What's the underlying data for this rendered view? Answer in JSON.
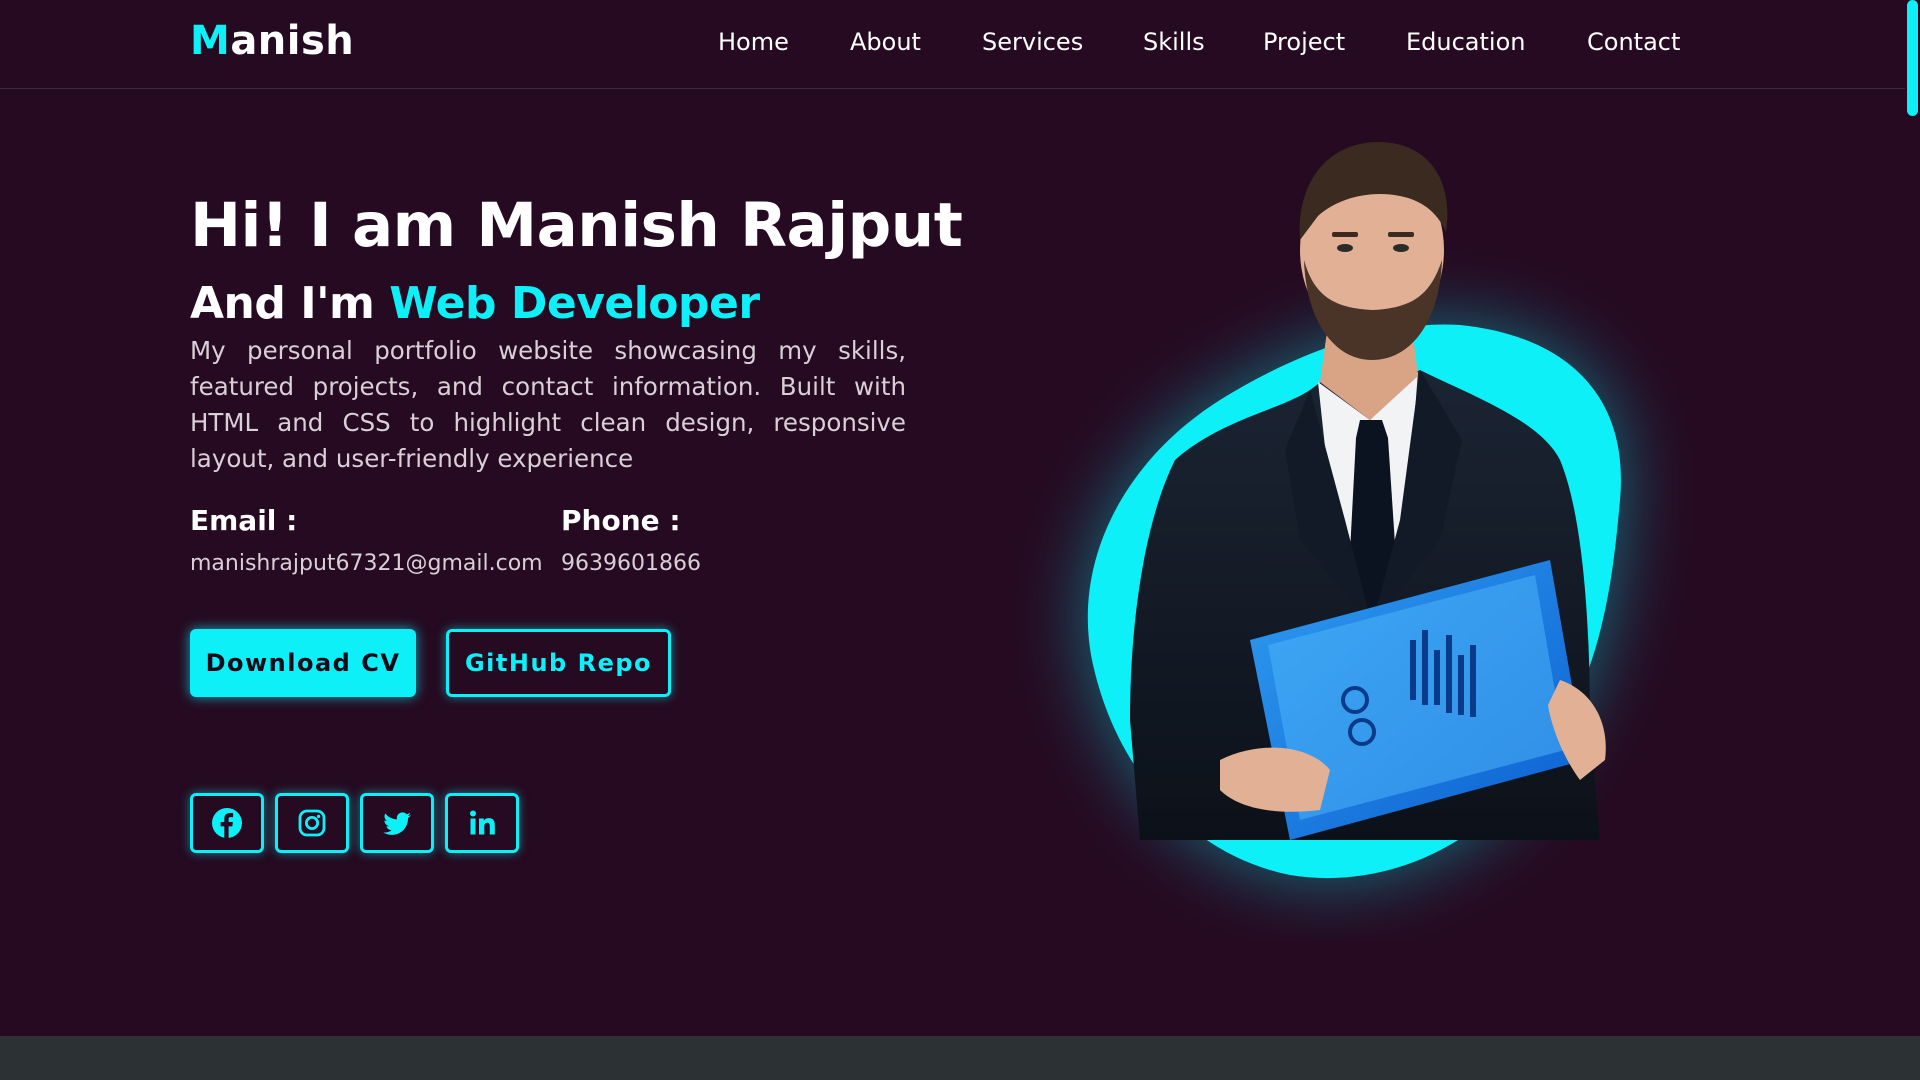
{
  "brand": {
    "logo_first": "M",
    "logo_rest": "anish"
  },
  "nav": [
    "Home",
    "About",
    "Services",
    "Skills",
    "Project",
    "Education",
    "Contact"
  ],
  "hero": {
    "headline": "Hi! I am Manish Rajput",
    "sub_prefix": "And I'm ",
    "sub_role": "Web Developer",
    "description": "My personal portfolio website showcasing my skills, featured projects, and contact information. Built with HTML and CSS to highlight clean design, responsive layout, and user-friendly experience",
    "email_label": "Email :",
    "email_value": "manishrajput67321@gmail.com",
    "phone_label": "Phone :",
    "phone_value": "9639601866",
    "cta_primary": "Download CV",
    "cta_secondary": "GitHub Repo"
  },
  "social_icons": [
    "facebook-icon",
    "instagram-icon",
    "twitter-icon",
    "linkedin-icon"
  ],
  "colors": {
    "background": "#250a21",
    "accent": "#0ef0f8",
    "text": "#ffffff",
    "muted_text": "#d9cfd6",
    "footer_strip": "#2c3133"
  }
}
